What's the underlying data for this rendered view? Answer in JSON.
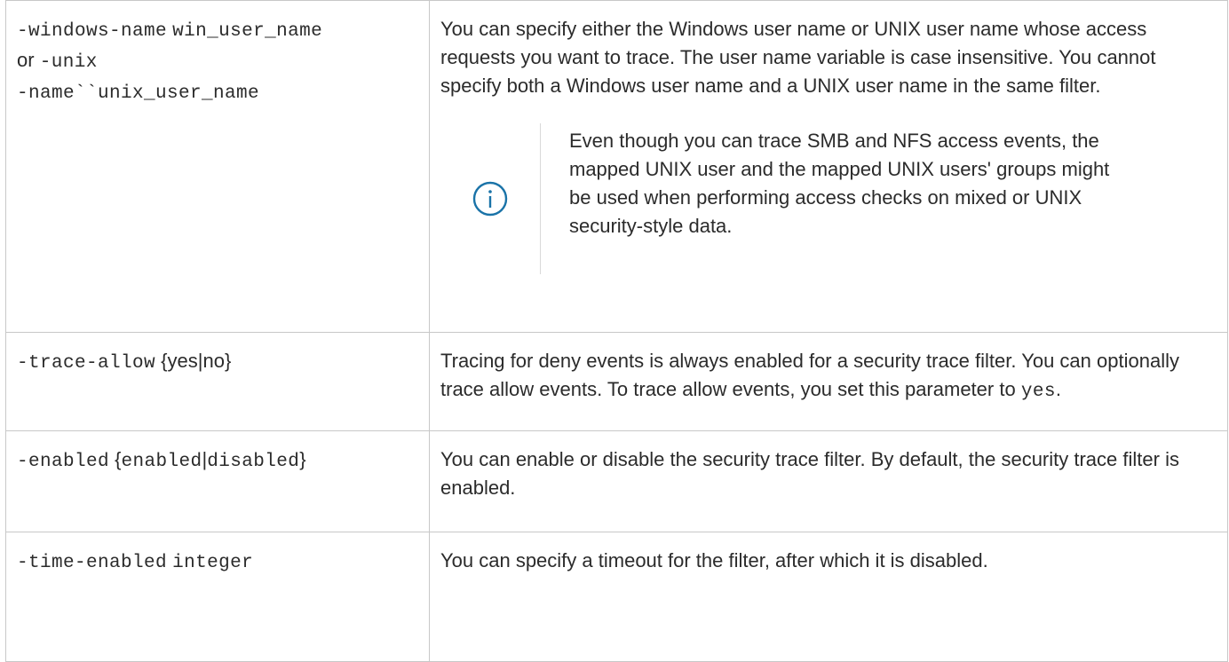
{
  "rows": [
    {
      "param": {
        "line1_code": "-windows-name",
        "line1_arg": "win_user_name",
        "line2_text": "or",
        "line2_code": "-unix",
        "line3_code": "-name``unix_user_name"
      },
      "description": "You can specify either the Windows user name or UNIX user name whose access requests you want to trace. The user name variable is case insensitive. You cannot specify both a Windows user name and a UNIX user name in the same filter.",
      "note": {
        "icon": "info-icon",
        "text": "Even though you can trace SMB and NFS access events, the mapped UNIX user and the mapped UNIX users' groups might be used when performing access checks on mixed or UNIX security-style data."
      }
    },
    {
      "param": {
        "code": "-trace-allow",
        "brace_open": "{",
        "opt1": "yes",
        "sep": "|",
        "opt2": "no",
        "brace_close": "}"
      },
      "description_prefix": "Tracing for deny events is always enabled for a security trace filter. You can optionally trace allow events. To trace allow events, you set this parameter to",
      "description_code": "yes",
      "description_suffix": "."
    },
    {
      "param": {
        "code": "-enabled",
        "brace_open": "{",
        "opt1": "enabled",
        "sep": "|",
        "opt2": "disabled",
        "brace_close": "}"
      },
      "description": "You can enable or disable the security trace filter. By default, the security trace filter is enabled."
    },
    {
      "param": {
        "code": "-time-enabled",
        "arg": "integer"
      },
      "description": "You can specify a timeout for the filter, after which it is disabled."
    }
  ],
  "colors": {
    "icon": "#1a73a8",
    "border": "#c8c8c8",
    "text": "#2b2b2b"
  }
}
